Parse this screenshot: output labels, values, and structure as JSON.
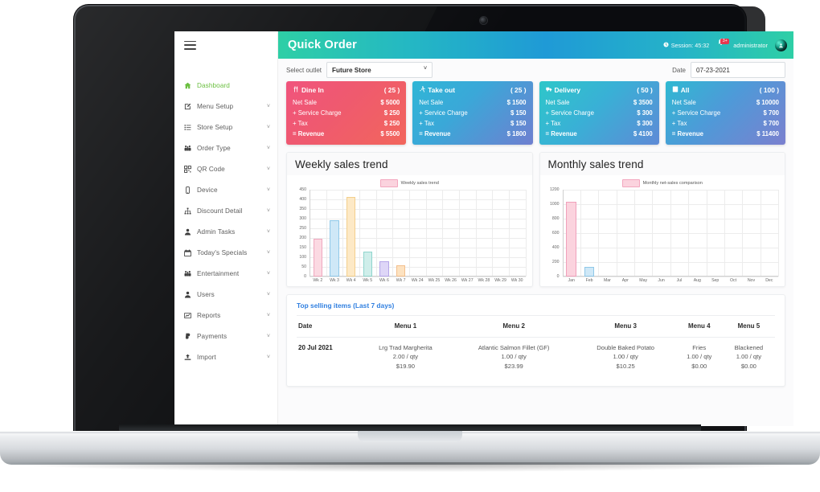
{
  "sidebar": {
    "menu_icon": "hamburger-icon",
    "items": [
      {
        "label": "Dashboard",
        "icon": "home-icon",
        "active": true,
        "chevron": false
      },
      {
        "label": "Menu Setup",
        "icon": "edit-square-icon",
        "active": false,
        "chevron": true
      },
      {
        "label": "Store Setup",
        "icon": "list-icon",
        "active": false,
        "chevron": true
      },
      {
        "label": "Order Type",
        "icon": "binoculars-icon",
        "active": false,
        "chevron": true
      },
      {
        "label": "QR Code",
        "icon": "qr-code-icon",
        "active": false,
        "chevron": true
      },
      {
        "label": "Device",
        "icon": "mobile-icon",
        "active": false,
        "chevron": true
      },
      {
        "label": "Discount Detail",
        "icon": "sitemap-icon",
        "active": false,
        "chevron": true
      },
      {
        "label": "Admin Tasks",
        "icon": "user-icon",
        "active": false,
        "chevron": true
      },
      {
        "label": "Today's Specials",
        "icon": "calendar-icon",
        "active": false,
        "chevron": true
      },
      {
        "label": "Entertainment",
        "icon": "binoculars-icon",
        "active": false,
        "chevron": true
      },
      {
        "label": "Users",
        "icon": "user-icon",
        "active": false,
        "chevron": true
      },
      {
        "label": "Reports",
        "icon": "chart-line-icon",
        "active": false,
        "chevron": true
      },
      {
        "label": "Payments",
        "icon": "paypal-icon",
        "active": false,
        "chevron": true
      },
      {
        "label": "Import",
        "icon": "upload-icon",
        "active": false,
        "chevron": true
      }
    ]
  },
  "topbar": {
    "brand": "Quick Order",
    "session_label": "Session: 45:32",
    "clock_icon": "clock-icon",
    "bell_icon": "bell-icon",
    "notification_count": "3+",
    "username": "administrator",
    "avatar_icon": "avatar-icon"
  },
  "outletbar": {
    "outlet_label": "Select outlet",
    "outlet_value": "Future Store",
    "outlet_options": [
      "Future Store"
    ],
    "date_label": "Date",
    "date_value": "07-23-2021"
  },
  "cards": [
    {
      "key": "dinein",
      "title": "Dine In",
      "icon": "cutlery-icon",
      "count": "( 25 )",
      "rows": [
        {
          "key": "Net Sale",
          "value": "$ 5000"
        },
        {
          "key": "+ Service Charge",
          "value": "$ 250"
        },
        {
          "key": "+ Tax",
          "value": "$ 250"
        },
        {
          "key": "= Revenue",
          "value": "$ 5500"
        }
      ]
    },
    {
      "key": "takeout",
      "title": "Take out",
      "icon": "runner-icon",
      "count": "( 25 )",
      "rows": [
        {
          "key": "Net Sale",
          "value": "$ 1500"
        },
        {
          "key": "+ Service Charge",
          "value": "$ 150"
        },
        {
          "key": "+ Tax",
          "value": "$ 150"
        },
        {
          "key": "= Revenue",
          "value": "$ 1800"
        }
      ]
    },
    {
      "key": "delivery",
      "title": "Delivery",
      "icon": "truck-icon",
      "count": "( 50 )",
      "rows": [
        {
          "key": "Net Sale",
          "value": "$ 3500"
        },
        {
          "key": "+ Service Charge",
          "value": "$ 300"
        },
        {
          "key": "+ Tax",
          "value": "$ 300"
        },
        {
          "key": "= Revenue",
          "value": "$ 4100"
        }
      ]
    },
    {
      "key": "all",
      "title": "All",
      "icon": "calculator-icon",
      "count": "( 100 )",
      "rows": [
        {
          "key": "Net Sale",
          "value": "$ 10000"
        },
        {
          "key": "+ Service Charge",
          "value": "$ 700"
        },
        {
          "key": "+ Tax",
          "value": "$ 700"
        },
        {
          "key": "= Revenue",
          "value": "$ 11400"
        }
      ]
    }
  ],
  "panels": {
    "weekly_title": "Weekly sales trend",
    "monthly_title": "Monthly sales trend"
  },
  "chart_data": [
    {
      "type": "bar",
      "title": "Weekly sales trend",
      "legend": [
        "Weekly sales trend"
      ],
      "legend_position": "top-center",
      "grid": true,
      "xlabel": "",
      "ylabel": "",
      "ylim": [
        0,
        450
      ],
      "yticks": [
        0,
        50,
        100,
        150,
        200,
        250,
        300,
        350,
        400,
        450
      ],
      "categories": [
        "Wk 2",
        "Wk 3",
        "Wk 4",
        "Wk 5",
        "Wk 6",
        "Wk 7",
        "Wk 24",
        "Wk 25",
        "Wk 26",
        "Wk 27",
        "Wk 28",
        "Wk 29",
        "Wk 30"
      ],
      "values": [
        195,
        291,
        414,
        130,
        77,
        58,
        0,
        0,
        0,
        0,
        0,
        0,
        0
      ],
      "bar_colors": [
        "#fbd9e2",
        "#cfe8f7",
        "#fde9c6",
        "#cfeeea",
        "#ded6f7",
        "#fde2c0",
        "",
        "",
        "",
        "",
        "",
        "",
        ""
      ],
      "bar_borders": [
        "#f0a8bf",
        "#8fc8e8",
        "#f3cf8c",
        "#8fd5cd",
        "#b5a6e8",
        "#f3bf8c",
        "",
        "",
        "",
        "",
        "",
        "",
        ""
      ]
    },
    {
      "type": "bar",
      "title": "Monthly sales trend",
      "legend": [
        "Monthly net-sales comparison"
      ],
      "legend_position": "top-center",
      "grid": true,
      "xlabel": "",
      "ylabel": "",
      "ylim": [
        0,
        1200
      ],
      "yticks": [
        0,
        200,
        400,
        600,
        800,
        1000,
        1200
      ],
      "categories": [
        "Jan",
        "Feb",
        "Mar",
        "Apr",
        "May",
        "Jun",
        "Jul",
        "Aug",
        "Sep",
        "Oct",
        "Nov",
        "Dec"
      ],
      "values": [
        1030,
        137,
        0,
        0,
        0,
        0,
        0,
        0,
        0,
        0,
        0,
        0
      ],
      "bar_colors": [
        "#fbd3de",
        "#cfe8f7",
        "",
        "",
        "",
        "",
        "",
        "",
        "",
        "",
        "",
        ""
      ],
      "bar_borders": [
        "#f0a0bb",
        "#8fc8e8",
        "",
        "",
        "",
        "",
        "",
        "",
        "",
        "",
        "",
        ""
      ]
    }
  ],
  "table": {
    "title": "Top selling items (Last 7 days)",
    "columns": [
      "Date",
      "Menu 1",
      "Menu 2",
      "Menu 3",
      "Menu 4",
      "Menu 5"
    ],
    "rows": [
      {
        "date": "20 Jul 2021",
        "cells": [
          {
            "name": "Lrg Trad Margherita",
            "qty": "2.00 / qty",
            "price": "$19.90"
          },
          {
            "name": "Atlantic Salmon Fillet (GF)",
            "qty": "1.00 / qty",
            "price": "$23.99"
          },
          {
            "name": "Double Baked Potato",
            "qty": "1.00 / qty",
            "price": "$10.25"
          },
          {
            "name": "Fries",
            "qty": "1.00 / qty",
            "price": "$0.00"
          },
          {
            "name": "Blackened",
            "qty": "1.00 / qty",
            "price": "$0.00"
          }
        ]
      }
    ]
  }
}
